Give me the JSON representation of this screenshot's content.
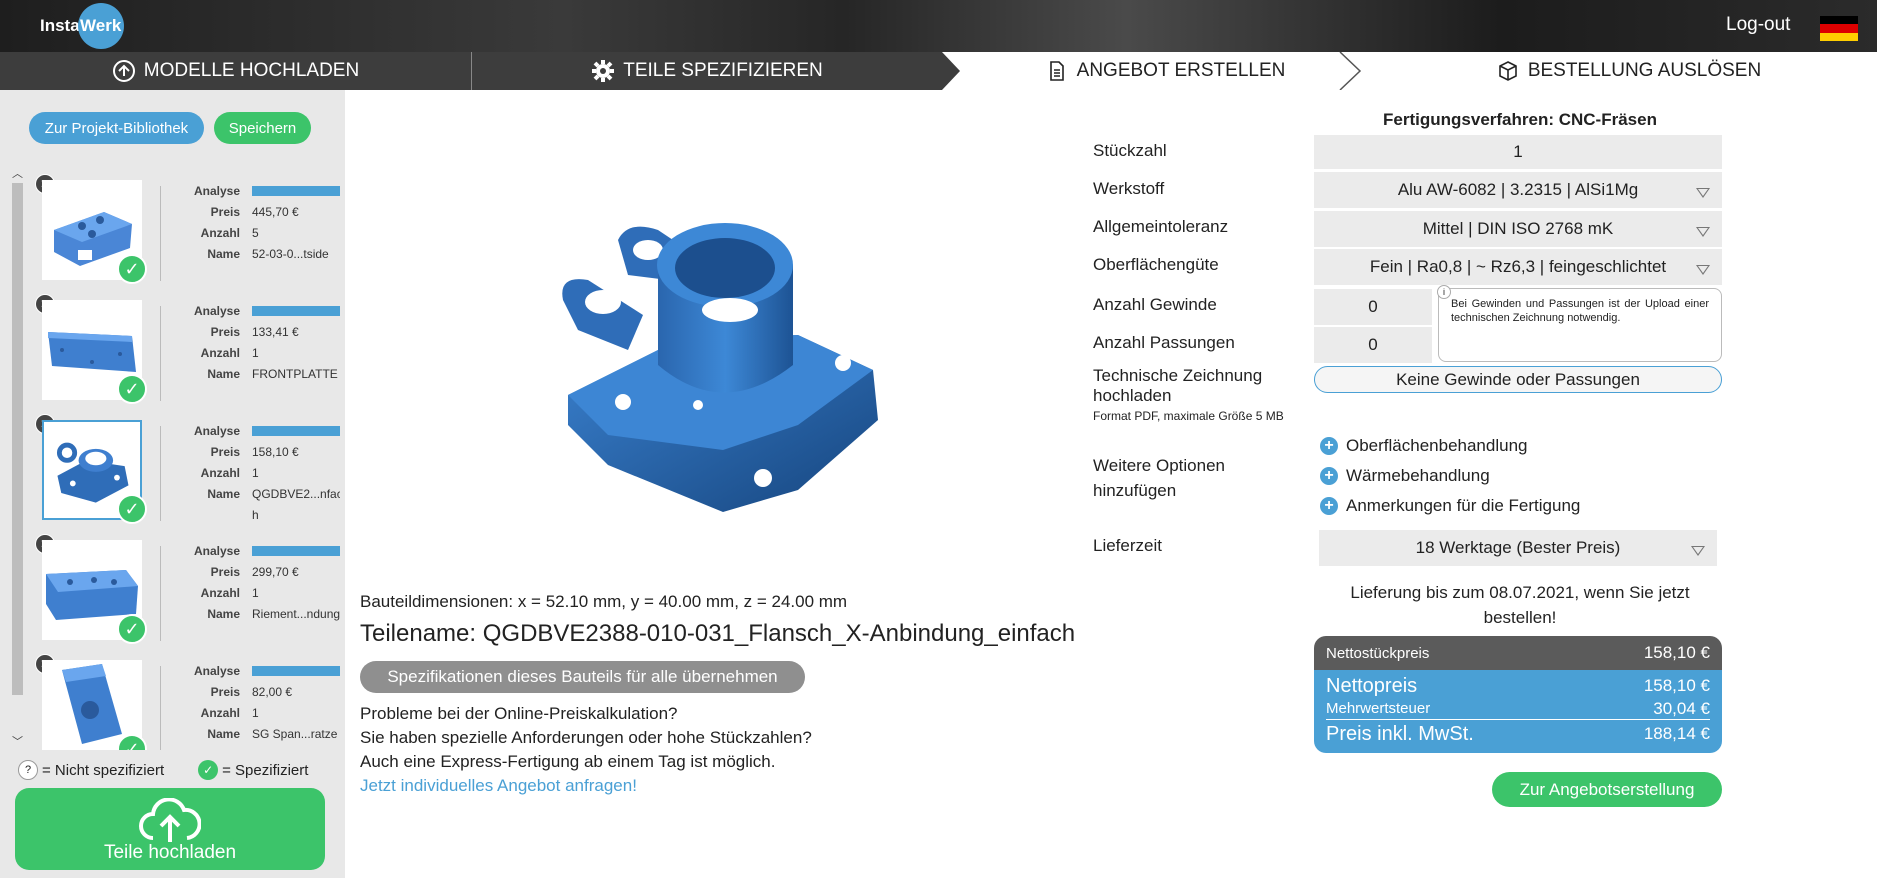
{
  "header": {
    "logo_left": "Insta",
    "logo_right": "Werk",
    "logout": "Log-out",
    "flag_colors": [
      "#000000",
      "#dd0000",
      "#ffce00"
    ]
  },
  "steps": [
    {
      "label": "MODELLE HOCHLADEN",
      "icon": "upload-circle-icon"
    },
    {
      "label": "TEILE SPEZIFIZIEREN",
      "icon": "gear-icon"
    },
    {
      "label": "ANGEBOT ERSTELLEN",
      "icon": "document-icon"
    },
    {
      "label": "BESTELLUNG AUSLÖSEN",
      "icon": "box-icon"
    }
  ],
  "sidebar": {
    "library_button": "Zur Projekt-Bibliothek",
    "save_button": "Speichern",
    "field_labels": {
      "analyse": "Analyse",
      "preis": "Preis",
      "anzahl": "Anzahl",
      "name": "Name"
    },
    "items": [
      {
        "preis": "445,70 €",
        "anzahl": "5",
        "name": "52-03-0...tside"
      },
      {
        "preis": "133,41 €",
        "anzahl": "1",
        "name": "FRONTPLATTE"
      },
      {
        "preis": "158,10 €",
        "anzahl": "1",
        "name": "QGDBVE2...nfac",
        "name2": "h"
      },
      {
        "preis": "299,70 €",
        "anzahl": "1",
        "name": "Riement...ndung"
      },
      {
        "preis": "82,00 €",
        "anzahl": "1",
        "name": "SG Span...ratze"
      }
    ],
    "legend_not": "= Nicht spezifiziert",
    "legend_yes": "= Spezifiziert",
    "legend_q": "?",
    "upload_button": "Teile hochladen"
  },
  "center": {
    "dimensions": "Bauteildimensionen: x = 52.10 mm, y = 40.00 mm, z = 24.00 mm",
    "partname": "Teilename: QGDBVE2388-010-031_Flansch_X-Anbindung_einfach",
    "apply_all_button": "Spezifikationen dieses Bauteils für alle übernehmen",
    "problems_line1": "Probleme bei der Online-Preiskalkulation?",
    "problems_line2": "Sie haben spezielle Anforderungen oder hohe Stückzahlen?",
    "problems_line3": "Auch eine Express-Fertigung ab einem Tag ist möglich.",
    "problems_link": "Jetzt individuelles Angebot anfragen!"
  },
  "form": {
    "verfahren": "Fertigungsverfahren: CNC-Fräsen",
    "stueckzahl_label": "Stückzahl",
    "stueckzahl": "1",
    "werkstoff_label": "Werkstoff",
    "werkstoff": "Alu AW-6082 | 3.2315 | AlSi1Mg",
    "toleranz_label": "Allgemeintoleranz",
    "toleranz": "Mittel | DIN ISO 2768 mK",
    "oberflaeche_label": "Oberflächengüte",
    "oberflaeche": "Fein | Ra0,8 | ~ Rz6,3 | feingeschlichtet",
    "gewinde_label": "Anzahl Gewinde",
    "gewinde": "0",
    "passungen_label": "Anzahl Passungen",
    "passungen": "0",
    "note": "Bei Gewinden und Passungen ist der Upload einer technischen Zeichnung notwendig.",
    "note_icon": "i",
    "zeichnung_label1": "Technische Zeichnung",
    "zeichnung_label2": "hochladen",
    "zeichnung_hint": "Format PDF, maximale Größe 5 MB",
    "kein_button": "Keine Gewinde oder Passungen",
    "optionen_label1": "Weitere Optionen",
    "optionen_label2": "hinzufügen",
    "options": [
      "Oberflächenbehandlung",
      "Wärmebehandlung",
      "Anmerkungen für die Fertigung"
    ],
    "lieferzeit_label": "Lieferzeit",
    "lieferzeit": "18 Werktage (Bester Preis)",
    "lieferung_text": "Lieferung bis zum 08.07.2021, wenn Sie jetzt bestellen!"
  },
  "prices": {
    "netto_stueck_label": "Nettostückpreis",
    "netto_stueck": "158,10 €",
    "netto_label": "Nettopreis",
    "netto": "158,10 €",
    "mwst_label": "Mehrwertsteuer",
    "mwst": "30,04 €",
    "brutto_label": "Preis inkl. MwSt.",
    "brutto": "188,14 €"
  },
  "angebot_button": "Zur Angebotserstellung",
  "colors": {
    "accent_blue": "#4aa0d5",
    "accent_green": "#3cc46a",
    "dark": "#3d3d3d"
  }
}
